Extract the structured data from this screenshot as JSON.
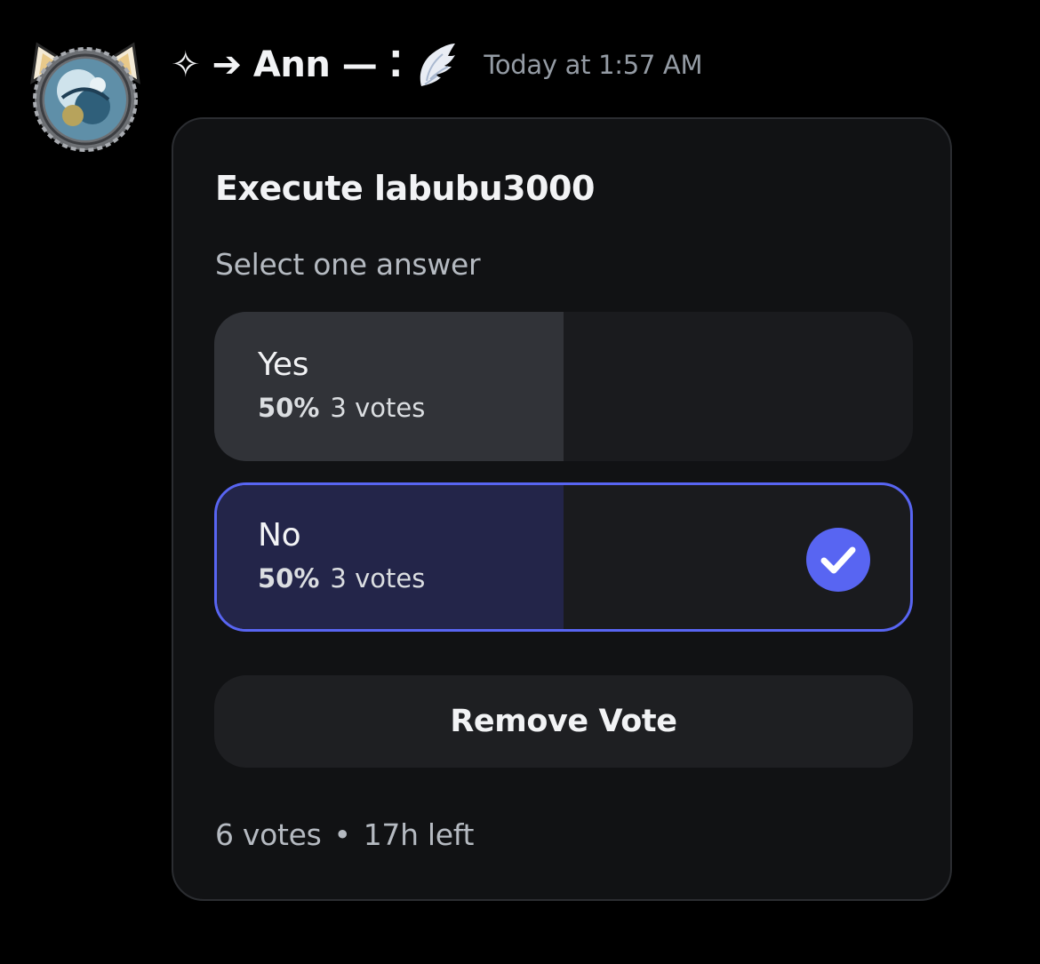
{
  "message": {
    "author": {
      "display_name": "✧ ➔ Ann —  ⁚",
      "avatar_icon": "avatar-cat-ears-icon",
      "name_decoration_icon": "angel-wing-icon"
    },
    "timestamp": "Today at 1:57 AM"
  },
  "poll": {
    "question": "Execute labubu3000",
    "hint": "Select one answer",
    "answers": [
      {
        "label": "Yes",
        "percent_text": "50%",
        "votes_text": "3 votes",
        "fraction": 0.5,
        "selected": false
      },
      {
        "label": "No",
        "percent_text": "50%",
        "votes_text": "3 votes",
        "fraction": 0.5,
        "selected": true
      }
    ],
    "remove_vote_label": "Remove Vote",
    "footer": {
      "total_votes": "6 votes",
      "separator": "•",
      "time_left": "17h left"
    }
  },
  "colors": {
    "accent": "#5865f2",
    "background": "#000000",
    "card": "#111214"
  }
}
